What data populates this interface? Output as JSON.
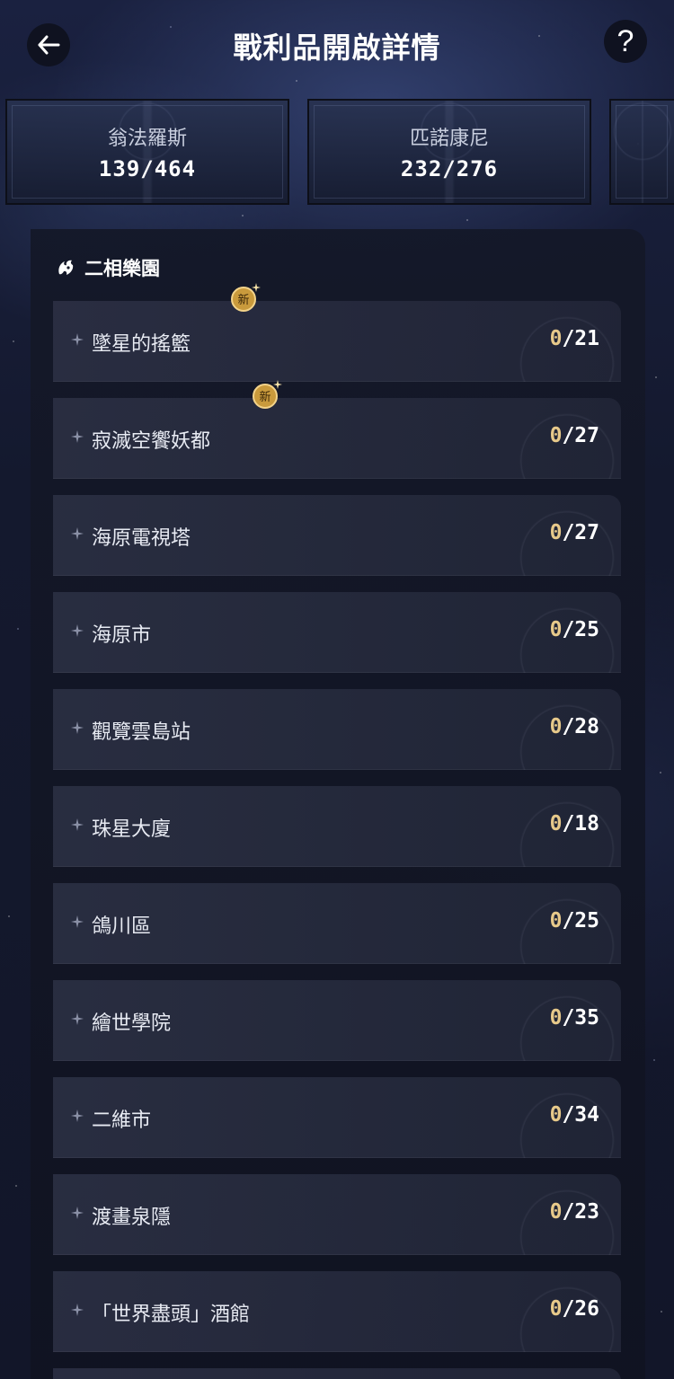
{
  "header": {
    "title": "戰利品開啟詳情",
    "help_label": "?"
  },
  "tabs": [
    {
      "name": "翁法羅斯",
      "count": "139/464"
    },
    {
      "name": "匹諾康尼",
      "count": "232/276"
    }
  ],
  "section": {
    "title": "二相樂園",
    "items": [
      {
        "label": "墜星的搖籃",
        "current": "0",
        "total": "/21",
        "is_new": true,
        "badge": "新"
      },
      {
        "label": "寂滅空饗妖都",
        "current": "0",
        "total": "/27",
        "is_new": true,
        "badge": "新"
      },
      {
        "label": "海原電視塔",
        "current": "0",
        "total": "/27",
        "is_new": false
      },
      {
        "label": "海原市",
        "current": "0",
        "total": "/25",
        "is_new": false
      },
      {
        "label": "觀覽雲島站",
        "current": "0",
        "total": "/28",
        "is_new": false
      },
      {
        "label": "珠星大廈",
        "current": "0",
        "total": "/18",
        "is_new": false
      },
      {
        "label": "鴿川區",
        "current": "0",
        "total": "/25",
        "is_new": false
      },
      {
        "label": "繪世學院",
        "current": "0",
        "total": "/35",
        "is_new": false
      },
      {
        "label": "二維市",
        "current": "0",
        "total": "/34",
        "is_new": false
      },
      {
        "label": "渡畫泉隱",
        "current": "0",
        "total": "/23",
        "is_new": false
      },
      {
        "label": "「世界盡頭」酒館",
        "current": "0",
        "total": "/26",
        "is_new": false
      }
    ]
  },
  "colors": {
    "accent_gold": "#e7c98a",
    "row_bg": "#2c3044",
    "panel_bg": "#141828"
  }
}
